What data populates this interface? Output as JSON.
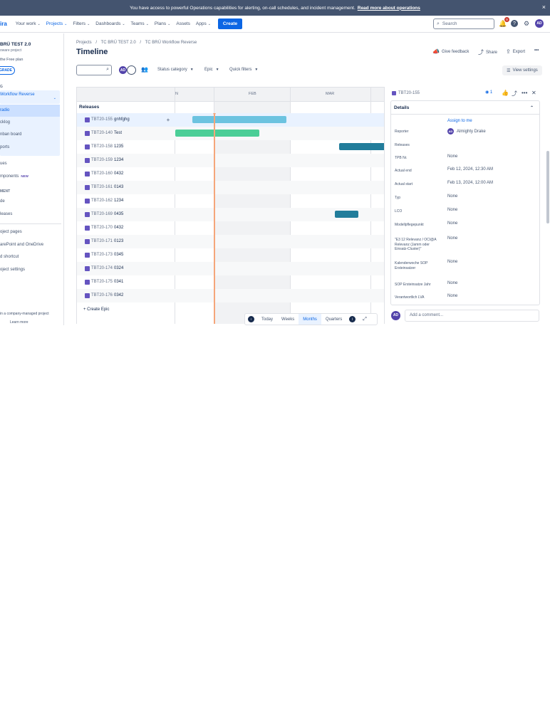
{
  "banner": {
    "message": "You have access to powerful Operations capabilities for alerting, on-call schedules, and incident management.",
    "link": "Read more about operations",
    "close": "×"
  },
  "topnav": {
    "logo": "ira",
    "items": [
      {
        "label": "Your work",
        "chev": "⌄"
      },
      {
        "label": "Projects",
        "chev": "⌄"
      },
      {
        "label": "Filters",
        "chev": "⌄"
      },
      {
        "label": "Dashboards",
        "chev": "⌄"
      },
      {
        "label": "Teams",
        "chev": "⌄"
      },
      {
        "label": "Plans",
        "chev": "⌄"
      },
      {
        "label": "Assets",
        "chev": ""
      },
      {
        "label": "Apps",
        "chev": "⌄"
      }
    ],
    "create": "Create",
    "search_placeholder": "Search",
    "notif_count": "9",
    "user_initials": "AD"
  },
  "sidebar": {
    "project_title": "BRÜ TEST 2.0",
    "project_sub": "oware project",
    "plan": "the Free plan",
    "upgrade": "GRADE",
    "section_planning": "G",
    "board": "Workflow Reverse",
    "board_items": [
      "radio",
      "cklog",
      "nban board",
      "ports"
    ],
    "issues": "ues",
    "components": "mponents",
    "new_badge": "NEW",
    "section_dev": "MENT",
    "code": "de",
    "releases": "leases",
    "project_pages": "oject pages",
    "sharepoint": "arePoint and OneDrive",
    "add_shortcut": "d shortcut",
    "project_settings": "oject settings",
    "footer": "in a company-managed project",
    "learn_more": "Learn more"
  },
  "breadcrumb": [
    "Projects",
    "/",
    "TC BRÜ TEST 2.0",
    "/",
    "TC BRÜ Workflow Reverse"
  ],
  "page_title": "Timeline",
  "top_actions": {
    "feedback": "Give feedback",
    "share": "Share",
    "export": "Export",
    "more": "•••"
  },
  "filters": {
    "status": "Status category",
    "epic": "Epic",
    "quick": "Quick filters",
    "view_settings": "View settings",
    "avatar_initials": "AD"
  },
  "timeline": {
    "months": [
      "N",
      "FEB",
      "MAR"
    ],
    "releases_label": "Releases",
    "create_epic": "+ Create Epic",
    "rows": [
      {
        "key": "TBT20-155",
        "summary": "gnhfghg",
        "bar_start": 0.08,
        "bar_len": 0.45,
        "color": "#6cc3e0"
      },
      {
        "key": "TBT20-140",
        "summary": "Test",
        "bar_start": 0.0,
        "bar_len": 0.4,
        "color": "#4bce97"
      },
      {
        "key": "TBT20-158",
        "summary": "1235",
        "bar_start": 0.78,
        "bar_len": 0.46,
        "color": "#227d9b"
      },
      {
        "key": "TBT20-159",
        "summary": "1234"
      },
      {
        "key": "TBT20-160",
        "summary": "0432"
      },
      {
        "key": "TBT20-161",
        "summary": "0143"
      },
      {
        "key": "TBT20-162",
        "summary": "1234"
      },
      {
        "key": "TBT20-169",
        "summary": "0435",
        "bar_start": 0.76,
        "bar_len": 0.11,
        "color": "#227d9b"
      },
      {
        "key": "TBT20-170",
        "summary": "0432"
      },
      {
        "key": "TBT20-171",
        "summary": "0123"
      },
      {
        "key": "TBT20-173",
        "summary": "0345"
      },
      {
        "key": "TBT20-174",
        "summary": "0324"
      },
      {
        "key": "TBT20-175",
        "summary": "0341"
      },
      {
        "key": "TBT20-176",
        "summary": "0342"
      }
    ]
  },
  "zoom": {
    "today": "Today",
    "weeks": "Weeks",
    "months": "Months",
    "quarters": "Quarters"
  },
  "detail": {
    "key": "TBT20-155",
    "watch_count": "1",
    "details_title": "Details",
    "assign": "Assign to me",
    "fields": [
      {
        "label": "Reporter",
        "value": "Almighty Drake"
      },
      {
        "label": "Releases",
        "value": ""
      },
      {
        "label": "TPB Nr.",
        "value": "None"
      },
      {
        "label": "Actual end",
        "value": "Feb 12, 2024, 12:30 AM"
      },
      {
        "label": "Actual start",
        "value": "Feb 13, 2024, 12:00 AM"
      },
      {
        "label": "Typ",
        "value": "None"
      },
      {
        "label": "LCO",
        "value": "None"
      },
      {
        "label": "Modellpflegepunkt",
        "value": "None"
      },
      {
        "label": "\"E3 12 Relevanz / OCI@A Relevanz (Jamm oder Einsatz-Cluster)\"",
        "value": "None"
      },
      {
        "label": "Kalenderwoche SOP Ersteinsatzer",
        "value": "None"
      },
      {
        "label": "SOP Ersteinsatze Jahr",
        "value": "None"
      },
      {
        "label": "Verantwortlich LVA",
        "value": "None"
      }
    ],
    "reporter_initials": "AD",
    "comment_placeholder": "Add a comment...",
    "comment_avatar": "AD"
  },
  "colors": {
    "accent": "#0c66e4",
    "banner": "#44546f",
    "issue": "#6554c0",
    "today_line": "#f5a67a"
  }
}
